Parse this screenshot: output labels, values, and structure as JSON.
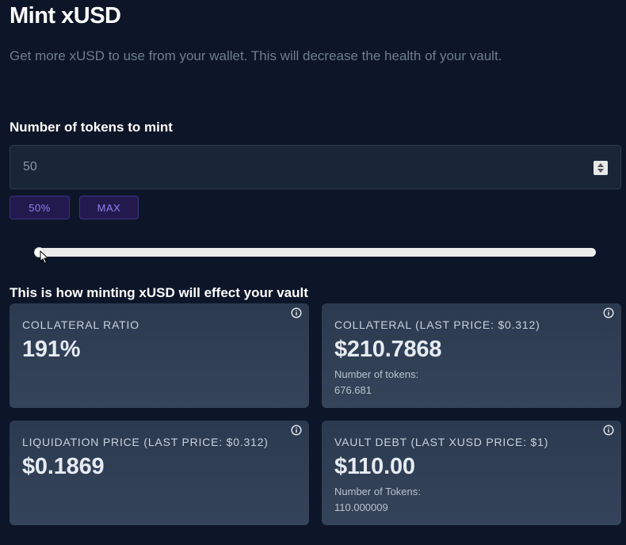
{
  "header": {
    "title": "Mint xUSD",
    "subtitle": "Get more xUSD to use from your wallet. This will decrease the health of your vault."
  },
  "mint_form": {
    "field_label": "Number of tokens to mint",
    "input_value": "50",
    "quick_buttons": {
      "fifty_percent": "50%",
      "max": "MAX"
    },
    "slider_fraction": 0
  },
  "effect": {
    "heading": "This is how minting xUSD will effect your vault",
    "cards": {
      "collateral_ratio": {
        "label": "COLLATERAL RATIO",
        "value": "191%"
      },
      "collateral": {
        "label": "COLLATERAL (LAST PRICE: $0.312)",
        "value": "$210.7868",
        "sub_label": "Number of tokens:",
        "sub_value": "676.681"
      },
      "liquidation_price": {
        "label": "LIQUIDATION PRICE (LAST PRICE: $0.312)",
        "value": "$0.1869"
      },
      "vault_debt": {
        "label": "VAULT DEBT (LAST XUSD PRICE: $1)",
        "value": "$110.00",
        "sub_label": "Number of Tokens:",
        "sub_value": "110.000009"
      }
    }
  },
  "icons": {
    "info": "info-icon",
    "stepper": "stepper-icon",
    "cursor": "pointer-cursor-icon"
  },
  "colors": {
    "background": "#0d1628",
    "pill_bg": "#221a4d",
    "pill_text": "#8f7ff0",
    "card_bg": "#2c3a50"
  }
}
